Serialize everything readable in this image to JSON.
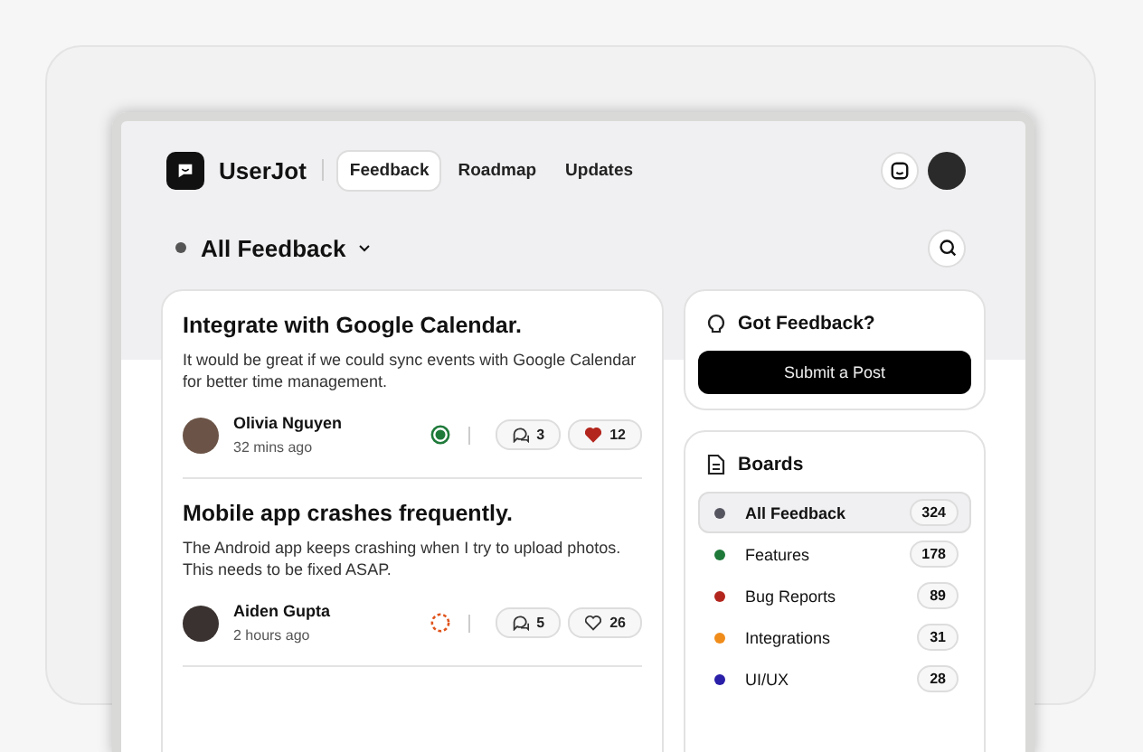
{
  "brand": "UserJot",
  "nav": [
    {
      "label": "Feedback",
      "selected": true
    },
    {
      "label": "Roadmap",
      "selected": false
    },
    {
      "label": "Updates",
      "selected": false
    }
  ],
  "filter": {
    "label": "All Feedback"
  },
  "posts": [
    {
      "title": "Integrate with Google Calendar.",
      "body": "It would be great if we could sync events with Google Calendar for better time management.",
      "author": "Olivia Nguyen",
      "time": "32 mins ago",
      "kind": "done",
      "comments": "3",
      "votes": "12",
      "voted": true
    },
    {
      "title": "Mobile app crashes frequently.",
      "body": "The Android app keeps crashing when I try to upload photos. This needs to be fixed ASAP.",
      "author": "Aiden Gupta",
      "time": "2 hours ago",
      "kind": "progress",
      "comments": "5",
      "votes": "26",
      "voted": false
    }
  ],
  "cta": {
    "title": "Got Feedback?",
    "button": "Submit a Post"
  },
  "boards": {
    "title": "Boards",
    "items": [
      {
        "name": "All Feedback",
        "count": "324",
        "color": "#555560",
        "selected": true
      },
      {
        "name": "Features",
        "count": "178",
        "color": "#1f7a3a",
        "selected": false
      },
      {
        "name": "Bug Reports",
        "count": "89",
        "color": "#b3261e",
        "selected": false
      },
      {
        "name": "Integrations",
        "count": "31",
        "color": "#f08c1a",
        "selected": false
      },
      {
        "name": "UI/UX",
        "count": "28",
        "color": "#2a1fa8",
        "selected": false
      }
    ]
  }
}
